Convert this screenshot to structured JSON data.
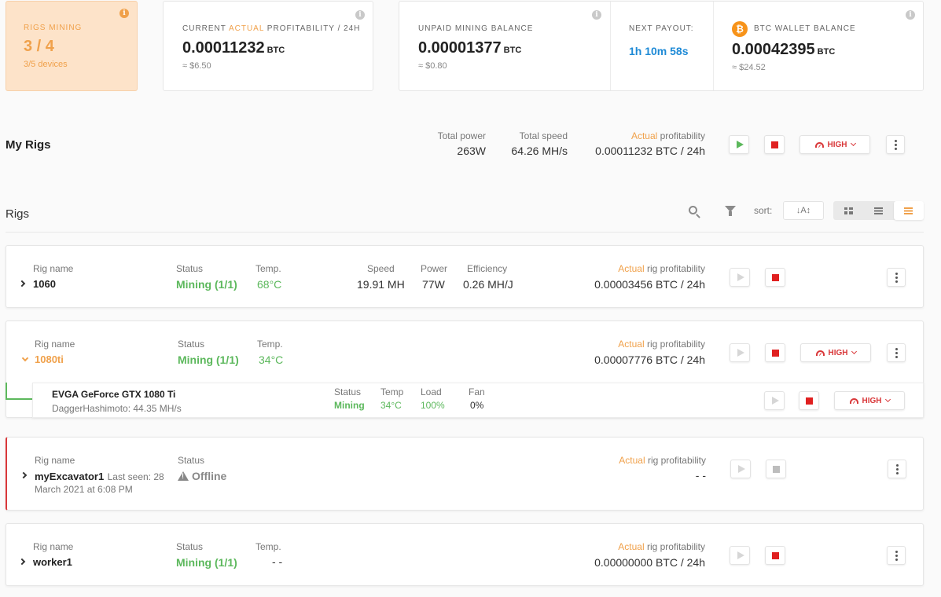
{
  "summary": {
    "rigs_mining": {
      "label": "RIGS MINING",
      "value": "3 / 4",
      "sub": "3/5 devices"
    },
    "profitability": {
      "label_pre": "CURRENT ",
      "label_accent": "ACTUAL",
      "label_post": " PROFITABILITY / 24H",
      "value": "0.00011232",
      "unit": "BTC",
      "sub": "≈ $6.50"
    },
    "unpaid": {
      "label": "UNPAID MINING BALANCE",
      "value": "0.00001377",
      "unit": "BTC",
      "sub": "≈ $0.80"
    },
    "next_payout": {
      "label": "NEXT PAYOUT:",
      "value": "1h 10m 58s"
    },
    "wallet": {
      "label": "BTC WALLET BALANCE",
      "value": "0.00042395",
      "unit": "BTC",
      "sub": "≈ $24.52",
      "coin": "₿"
    },
    "info_glyph": "i"
  },
  "my_rigs": {
    "title": "My Rigs",
    "total_power_label": "Total power",
    "total_power": "263W",
    "total_speed_label": "Total speed",
    "total_speed": "64.26 MH/s",
    "profit_label_accent": "Actual",
    "profit_label_rest": " profitability",
    "profit_value": "0.00011232 BTC / 24h",
    "power_mode": "HIGH"
  },
  "toolbar": {
    "title": "Rigs",
    "sort_label": "sort:",
    "sort_glyph": "↓A↕"
  },
  "labels": {
    "rig_name": "Rig name",
    "status": "Status",
    "temp": "Temp.",
    "speed": "Speed",
    "power": "Power",
    "efficiency": "Efficiency",
    "actual": "Actual",
    "rig_profit": " rig profitability"
  },
  "rigs": [
    {
      "name": "1060",
      "status": "Mining (1/1)",
      "temp": "68°C",
      "speed": "19.91 MH",
      "power": "77W",
      "efficiency": "0.26 MH/J",
      "profit": "0.00003456 BTC / 24h"
    },
    {
      "name": "1080ti",
      "status": "Mining (1/1)",
      "temp": "34°C",
      "profit": "0.00007776 BTC / 24h",
      "power_mode": "HIGH",
      "device": {
        "name": "EVGA GeForce GTX 1080 Ti",
        "algo": "DaggerHashimoto: 44.35 MH/s",
        "status_label": "Status",
        "status": "Mining",
        "temp_label": "Temp",
        "temp": "34°C",
        "load_label": "Load",
        "load": "100%",
        "fan_label": "Fan",
        "fan": "0%",
        "power_mode": "HIGH"
      }
    },
    {
      "name": "myExcavator1",
      "last_seen_1": "Last seen: 28",
      "last_seen_2": "March 2021 at 6:08 PM",
      "status": "Offline",
      "profit": "- -"
    },
    {
      "name": "worker1",
      "status": "Mining (1/1)",
      "temp": "- -",
      "profit": "0.00000000 BTC / 24h"
    }
  ],
  "colors": {
    "accent": "#f0a14b",
    "mining": "#5cb85c",
    "stop": "#e02020",
    "btc": "#f7931a"
  }
}
